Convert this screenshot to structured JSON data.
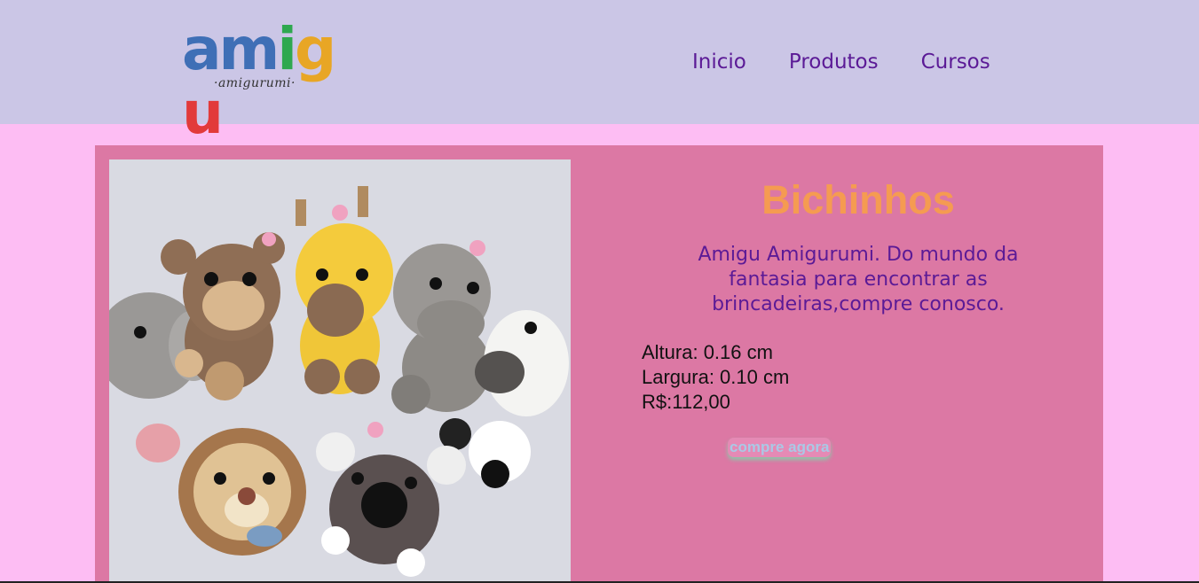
{
  "logo": {
    "word_letters": [
      {
        "ch": "a",
        "color": "#3f6fb6"
      },
      {
        "ch": "m",
        "color": "#3f6fb6"
      },
      {
        "ch": "i",
        "color": "#2ea84f"
      },
      {
        "ch": "g",
        "color": "#e8a625"
      },
      {
        "ch": "u",
        "color": "#e23a3a"
      }
    ],
    "sub": "·amigurumi·"
  },
  "nav": {
    "items": [
      "Inicio",
      "Produtos",
      "Cursos"
    ]
  },
  "product": {
    "title": "Bichinhos",
    "description": "Amigu Amigurumi. Do mundo da fantasia para encontrar as brincadeiras,compre conosco.",
    "height": "Altura: 0.16 cm",
    "width": "Largura: 0.10 cm",
    "price": "R$:112,00",
    "buy_label": "compre agora",
    "image_icon": "amigurumi-animals-photo"
  },
  "colors": {
    "header_bg": "#cbc6e6",
    "page_bg": "#fdbdf3",
    "card_bg": "#dc78a4",
    "title": "#f59b51",
    "nav_text": "#5b1a96"
  }
}
